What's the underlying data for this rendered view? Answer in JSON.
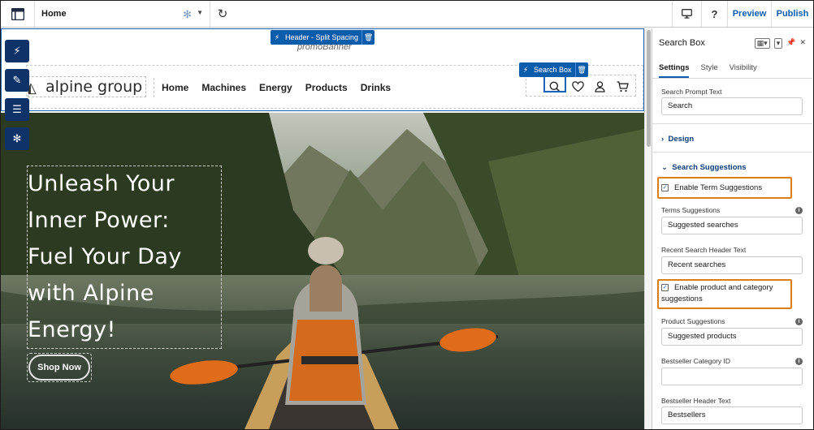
{
  "topbar": {
    "app_icon": "layout-icon",
    "page_name": "Home",
    "preview": "Preview",
    "publish": "Publish",
    "help": "?"
  },
  "canvas": {
    "header_chip": "Header - Split Spacing",
    "promo_banner": "promoBanner",
    "logo_text": "alpine group",
    "nav": [
      "Home",
      "Machines",
      "Energy",
      "Products",
      "Drinks"
    ],
    "search_chip": "Search Box",
    "hero_lines": [
      "Unleash Your",
      "Inner Power:",
      "Fuel Your Day",
      "with Alpine",
      "Energy!"
    ],
    "shop_now": "Shop Now"
  },
  "panel": {
    "title": "Search Box",
    "tabs": [
      "Settings",
      "Style",
      "Visibility"
    ],
    "search_prompt_label": "Search Prompt Text",
    "search_prompt_value": "Search",
    "design_section": "Design",
    "suggestions_section": "Search Suggestions",
    "enable_terms": "Enable Term Suggestions",
    "terms_label": "Terms Suggestions",
    "terms_value": "Suggested searches",
    "recent_label": "Recent Search Header Text",
    "recent_value": "Recent searches",
    "enable_product_line1": "Enable product and category",
    "enable_product_line2": "suggestions",
    "product_label": "Product Suggestions",
    "product_value": "Suggested products",
    "bestseller_cat_label": "Bestseller Category ID",
    "bestseller_cat_value": "",
    "bestseller_header_label": "Bestseller Header Text",
    "bestseller_header_value": "Bestsellers"
  },
  "colors": {
    "accent": "#0b5cab",
    "toolbar_dark": "#0f3268",
    "highlight": "#d97f14"
  }
}
